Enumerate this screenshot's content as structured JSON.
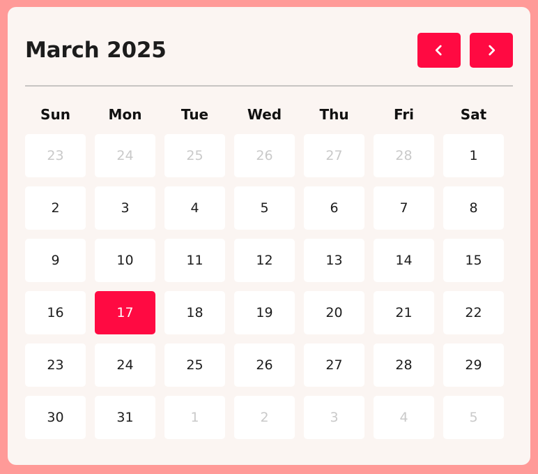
{
  "calendar": {
    "title": "March 2025",
    "prev_icon": "chevron-left-icon",
    "next_icon": "chevron-right-icon",
    "accent_color": "#ff0a42",
    "weekdays": [
      "Sun",
      "Mon",
      "Tue",
      "Wed",
      "Thu",
      "Fri",
      "Sat"
    ],
    "weeks": [
      [
        {
          "label": "23",
          "muted": true
        },
        {
          "label": "24",
          "muted": true
        },
        {
          "label": "25",
          "muted": true
        },
        {
          "label": "26",
          "muted": true
        },
        {
          "label": "27",
          "muted": true
        },
        {
          "label": "28",
          "muted": true
        },
        {
          "label": "1"
        }
      ],
      [
        {
          "label": "2"
        },
        {
          "label": "3"
        },
        {
          "label": "4"
        },
        {
          "label": "5"
        },
        {
          "label": "6"
        },
        {
          "label": "7"
        },
        {
          "label": "8"
        }
      ],
      [
        {
          "label": "9"
        },
        {
          "label": "10"
        },
        {
          "label": "11"
        },
        {
          "label": "12"
        },
        {
          "label": "13"
        },
        {
          "label": "14"
        },
        {
          "label": "15"
        }
      ],
      [
        {
          "label": "16"
        },
        {
          "label": "17",
          "selected": true
        },
        {
          "label": "18"
        },
        {
          "label": "19"
        },
        {
          "label": "20"
        },
        {
          "label": "21"
        },
        {
          "label": "22"
        }
      ],
      [
        {
          "label": "23"
        },
        {
          "label": "24"
        },
        {
          "label": "25"
        },
        {
          "label": "26"
        },
        {
          "label": "27"
        },
        {
          "label": "28"
        },
        {
          "label": "29"
        }
      ],
      [
        {
          "label": "30"
        },
        {
          "label": "31"
        },
        {
          "label": "1",
          "muted": true
        },
        {
          "label": "2",
          "muted": true
        },
        {
          "label": "3",
          "muted": true
        },
        {
          "label": "4",
          "muted": true
        },
        {
          "label": "5",
          "muted": true
        }
      ]
    ]
  }
}
